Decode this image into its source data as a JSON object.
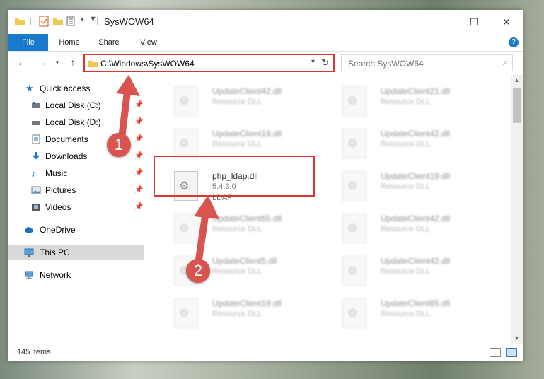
{
  "window": {
    "title": "SysWOW64",
    "controls": {
      "minimize": "—",
      "maximize": "☐",
      "close": "✕"
    }
  },
  "ribbon": {
    "tabs": [
      "File",
      "Home",
      "Share",
      "View"
    ],
    "help": "?"
  },
  "address": {
    "path": "C:\\Windows\\SysWOW64",
    "search_placeholder": "Search SysWOW64"
  },
  "sidebar": {
    "quick_access": "Quick access",
    "pinned": [
      {
        "label": "Local Disk (C:)",
        "icon": "drive-icon"
      },
      {
        "label": "Local Disk (D:)",
        "icon": "drive-icon"
      },
      {
        "label": "Documents",
        "icon": "documents-icon"
      },
      {
        "label": "Downloads",
        "icon": "downloads-icon"
      },
      {
        "label": "Music",
        "icon": "music-icon"
      },
      {
        "label": "Pictures",
        "icon": "pictures-icon"
      },
      {
        "label": "Videos",
        "icon": "videos-icon"
      }
    ],
    "onedrive": "OneDrive",
    "this_pc": "This PC",
    "network": "Network"
  },
  "files": {
    "col1": [
      {
        "name": "UpdateClient42.dll",
        "desc": "Resource DLL"
      },
      {
        "name": "UpdateClient19.dll",
        "desc": "Resource DLL"
      },
      {
        "name": "php_ldap.dll",
        "version": "5.4.3.0",
        "desc": "LDAP"
      },
      {
        "name": "UpdateClient65.dll",
        "desc": "Resource DLL"
      },
      {
        "name": "UpdateClient5.dll",
        "desc": "Resource DLL"
      },
      {
        "name": "UpdateClient19.dll",
        "desc": "Resource DLL"
      }
    ],
    "col2": [
      {
        "name": "UpdateClient21.dll",
        "desc": "Resource DLL"
      },
      {
        "name": "UpdateClient42.dll",
        "desc": "Resource DLL"
      },
      {
        "name": "UpdateClient19.dll",
        "desc": "Resource DLL"
      },
      {
        "name": "UpdateClient42.dll",
        "desc": "Resource DLL"
      },
      {
        "name": "UpdateClient42.dll",
        "desc": "Resource DLL"
      },
      {
        "name": "UpdateClient65.dll",
        "desc": "Resource DLL"
      }
    ]
  },
  "status": {
    "item_count": "145 items"
  },
  "markers": [
    "1",
    "2"
  ],
  "colors": {
    "accent": "#1979ca",
    "highlight": "#dd3333",
    "marker": "#d9534f"
  }
}
